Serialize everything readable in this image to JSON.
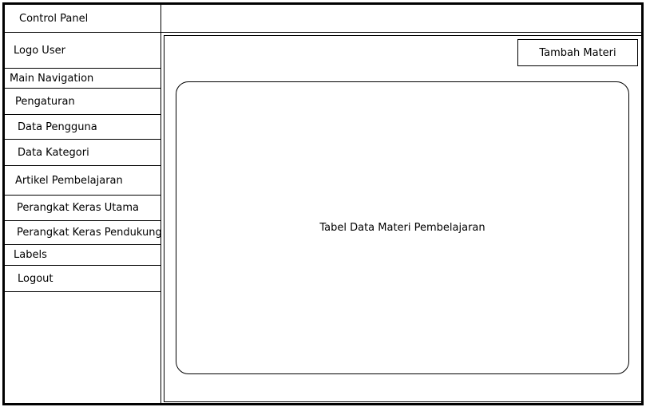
{
  "header": {
    "title": "Control Panel"
  },
  "sidebar": {
    "logo_label": "Logo User",
    "section_main": "Main Navigation",
    "items": [
      {
        "label": "Pengaturan"
      },
      {
        "label": "Data Pengguna"
      },
      {
        "label": "Data Kategori"
      },
      {
        "label": "Artikel Pembelajaran"
      },
      {
        "label": "Perangkat Keras Utama"
      },
      {
        "label": "Perangkat Keras Pendukung"
      }
    ],
    "section_labels": "Labels",
    "logout_label": "Logout"
  },
  "main": {
    "add_button_label": "Tambah Materi",
    "table_placeholder": "Tabel Data Materi Pembelajaran"
  }
}
